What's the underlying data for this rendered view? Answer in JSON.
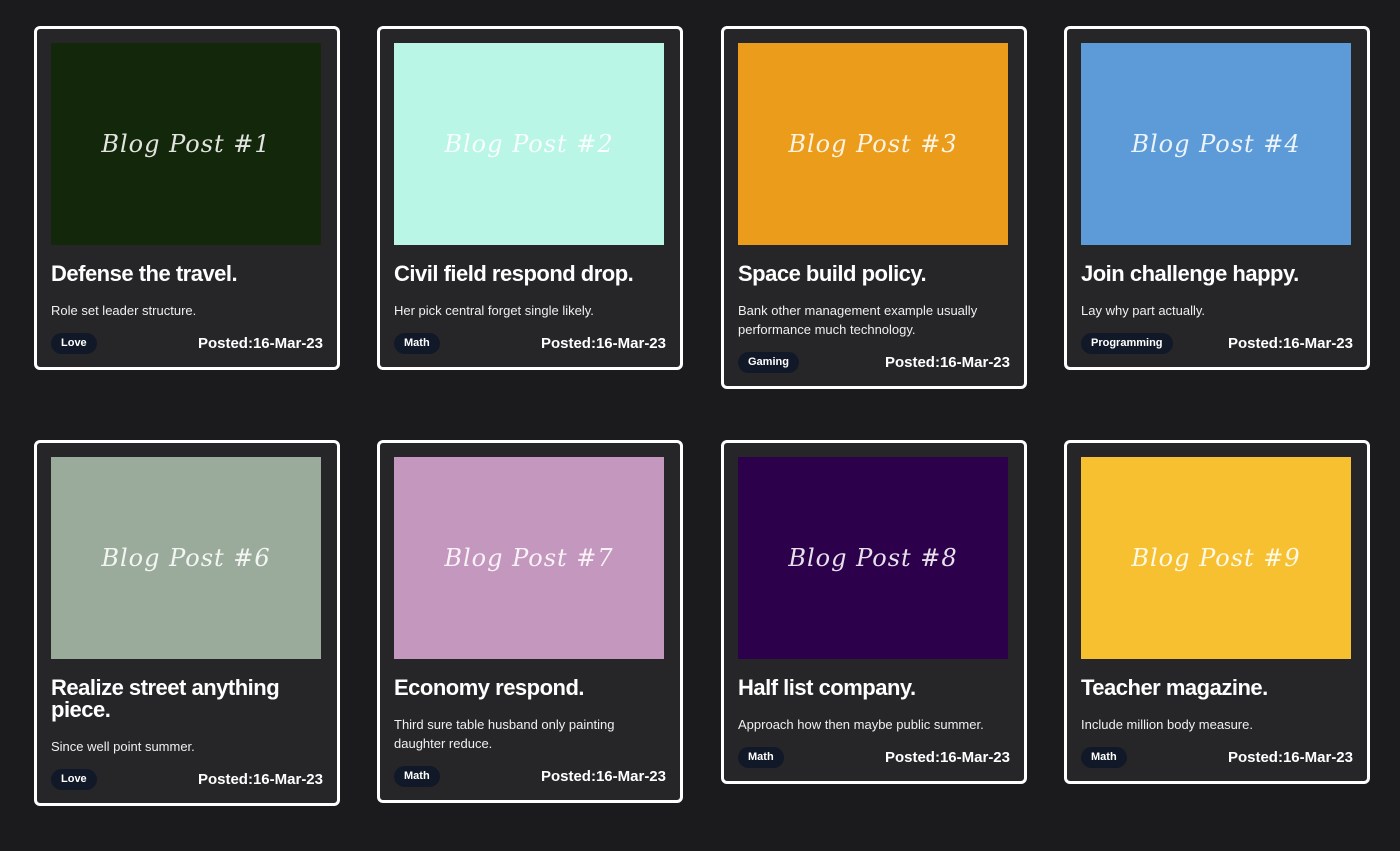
{
  "posts": [
    {
      "thumb_label": "Blog Post #1",
      "thumb_color": "#13270a",
      "title": "Defense the travel.",
      "description": "Role set leader structure.",
      "tag": "Love",
      "posted": "Posted:16-Mar-23"
    },
    {
      "thumb_label": "Blog Post #2",
      "thumb_color": "#baf6e5",
      "title": "Civil field respond drop.",
      "description": "Her pick central forget single likely.",
      "tag": "Math",
      "posted": "Posted:16-Mar-23"
    },
    {
      "thumb_label": "Blog Post #3",
      "thumb_color": "#ec9c1b",
      "title": "Space build policy.",
      "description": "Bank other management example usually performance much technology.",
      "tag": "Gaming",
      "posted": "Posted:16-Mar-23"
    },
    {
      "thumb_label": "Blog Post #4",
      "thumb_color": "#5c9bd8",
      "title": "Join challenge happy.",
      "description": "Lay why part actually.",
      "tag": "Programming",
      "posted": "Posted:16-Mar-23"
    },
    {
      "thumb_label": "Blog Post #6",
      "thumb_color": "#9aab9c",
      "title": "Realize street anything piece.",
      "description": "Since well point summer.",
      "tag": "Love",
      "posted": "Posted:16-Mar-23"
    },
    {
      "thumb_label": "Blog Post #7",
      "thumb_color": "#c497bf",
      "title": "Economy respond.",
      "description": "Third sure table husband only painting daughter reduce.",
      "tag": "Math",
      "posted": "Posted:16-Mar-23"
    },
    {
      "thumb_label": "Blog Post #8",
      "thumb_color": "#2d004c",
      "title": "Half list company.",
      "description": "Approach how then maybe public summer.",
      "tag": "Math",
      "posted": "Posted:16-Mar-23"
    },
    {
      "thumb_label": "Blog Post #9",
      "thumb_color": "#f6c030",
      "title": "Teacher magazine.",
      "description": "Include million body measure.",
      "tag": "Math",
      "posted": "Posted:16-Mar-23"
    }
  ]
}
